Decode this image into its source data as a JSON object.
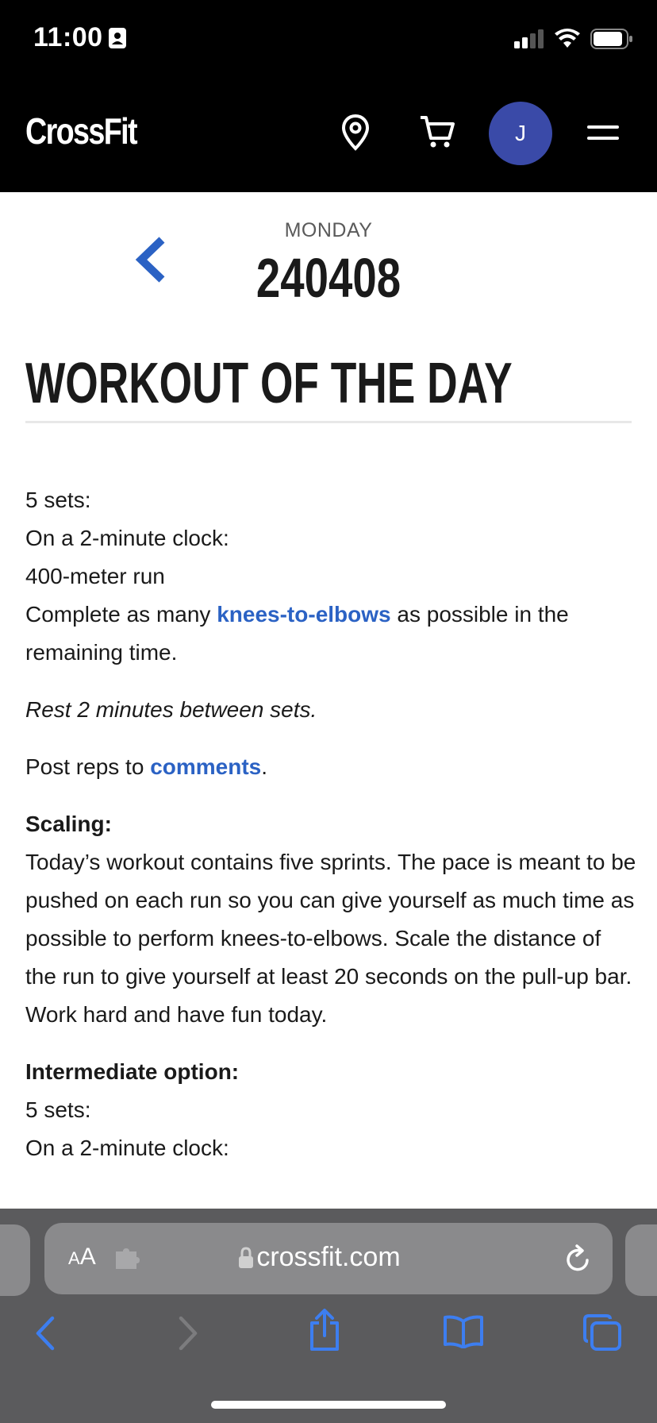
{
  "status_bar": {
    "time": "11:00"
  },
  "header": {
    "logo": "CrossFit",
    "avatar_initial": "J"
  },
  "day": {
    "label": "MONDAY",
    "number": "240408"
  },
  "section_title": "WORKOUT OF THE DAY",
  "workout": {
    "line1": "5 sets:",
    "line2": "On a 2-minute clock:",
    "line3": "400-meter run",
    "line4_pre": "Complete as many ",
    "line4_link": "knees-to-elbows",
    "line4_post": " as possible in the remaining time.",
    "rest": "Rest 2 minutes between sets.",
    "post_pre": "Post reps to ",
    "post_link": "comments",
    "post_post": "."
  },
  "scaling": {
    "heading": "Scaling:",
    "text": "Today’s workout contains five sprints. The pace is meant to be pushed on each run so you can give yourself as much time as possible to perform knees-to-elbows. Scale the distance of the run to give yourself at least 20 seconds on the pull-up bar. Work hard and have fun today."
  },
  "intermediate": {
    "heading": "Intermediate option:",
    "line1": "5 sets:",
    "line2": "On a 2-minute clock:"
  },
  "browser": {
    "aa_small": "A",
    "aa_large": "A",
    "url": "crossfit.com"
  },
  "colors": {
    "link": "#2b62c4",
    "avatar": "#3a4aa8",
    "toolbar_icon": "#3d7ef0"
  }
}
